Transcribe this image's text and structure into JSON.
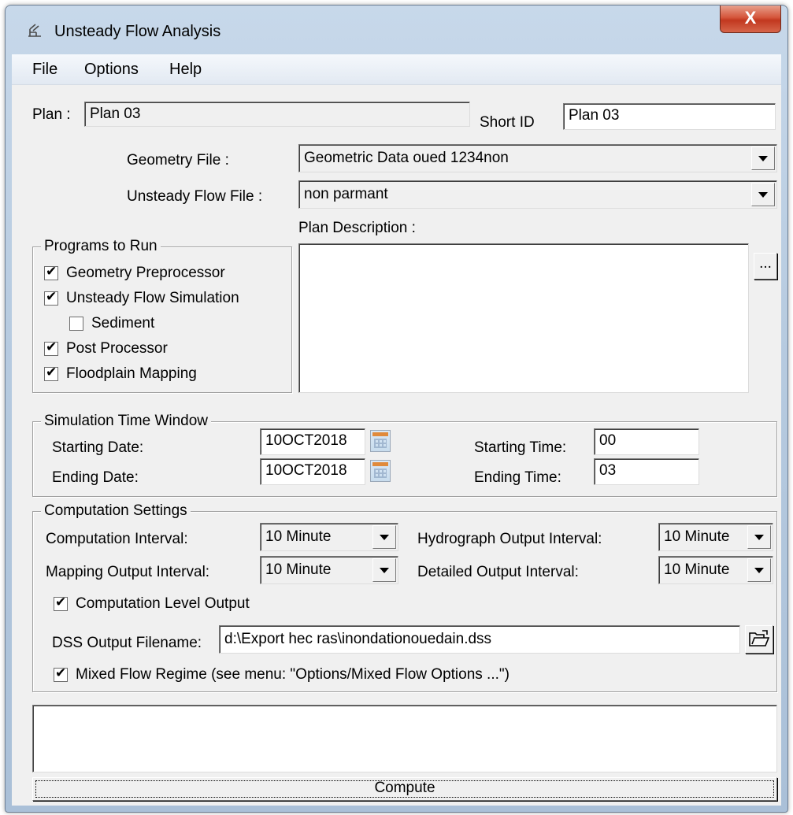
{
  "window": {
    "title": "Unsteady Flow Analysis",
    "close_label": "X"
  },
  "menu": {
    "file": "File",
    "options": "Options",
    "help": "Help"
  },
  "plan": {
    "label": "Plan :",
    "value": "Plan 03",
    "short_id_label": "Short ID",
    "short_id_value": "Plan 03"
  },
  "geometry": {
    "label": "Geometry File :",
    "value": "Geometric Data oued 1234non"
  },
  "unsteady": {
    "label": "Unsteady Flow File :",
    "value": "non parmant"
  },
  "description": {
    "label": "Plan Description :",
    "value": "",
    "more_label": "..."
  },
  "programs": {
    "title": "Programs to Run",
    "geometry_preprocessor": "Geometry Preprocessor",
    "unsteady_flow_simulation": "Unsteady Flow Simulation",
    "sediment": "Sediment",
    "post_processor": "Post Processor",
    "floodplain_mapping": "Floodplain Mapping"
  },
  "time_window": {
    "title": "Simulation Time Window",
    "start_date_label": "Starting Date:",
    "start_date": "10OCT2018",
    "end_date_label": "Ending Date:",
    "end_date": "10OCT2018",
    "start_time_label": "Starting Time:",
    "start_time": "00",
    "end_time_label": "Ending Time:",
    "end_time": "03"
  },
  "computation": {
    "title": "Computation Settings",
    "interval_label": "Computation Interval:",
    "interval": "10 Minute",
    "hydrograph_label": "Hydrograph Output Interval:",
    "hydrograph": "10 Minute",
    "mapping_label": "Mapping Output Interval:",
    "mapping": "10 Minute",
    "detailed_label": "Detailed Output Interval:",
    "detailed": "10 Minute",
    "level_output_label": "Computation Level Output",
    "dss_label": "DSS Output Filename:",
    "dss_value": "d:\\Export hec ras\\inondationouedain.dss",
    "mixed_flow_label": "Mixed Flow Regime (see menu: \"Options/Mixed Flow Options ...\")"
  },
  "status": {
    "text": ""
  },
  "compute_label": "Compute"
}
